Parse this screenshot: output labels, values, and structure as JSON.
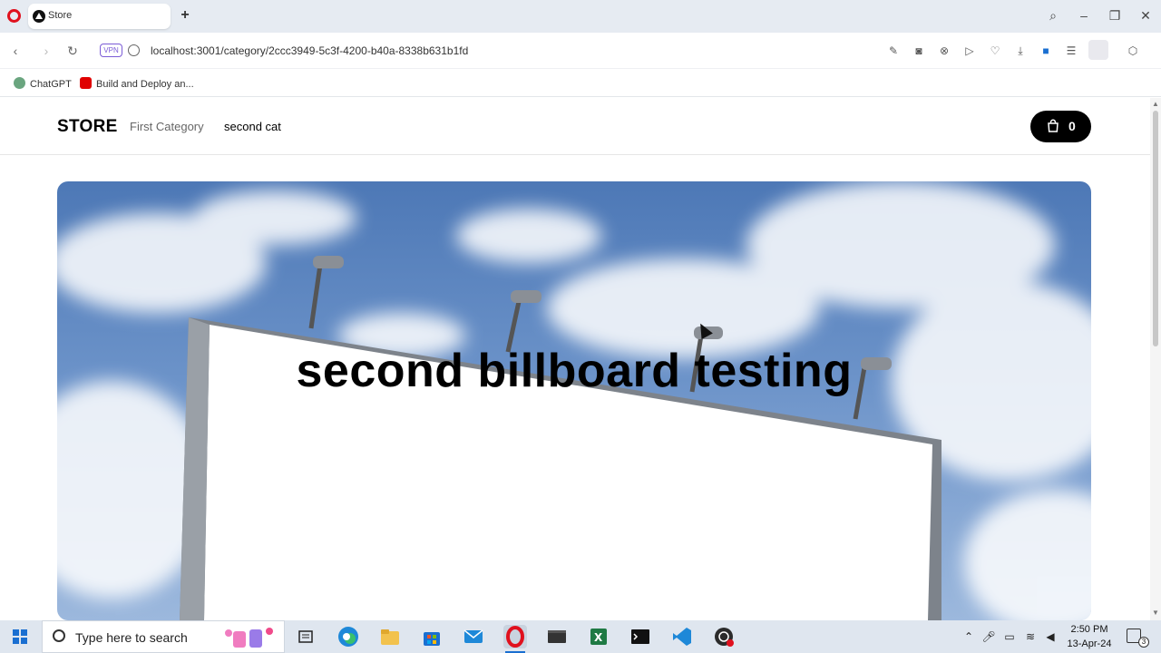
{
  "browser": {
    "tab_title": "Store",
    "url": "localhost:3001/category/2ccc3949-5c3f-4200-b40a-8338b631b1fd",
    "vpn_label": "VPN",
    "bookmarks": [
      "ChatGPT",
      "Build and Deploy an..."
    ]
  },
  "store": {
    "brand": "STORE",
    "nav": [
      "First Category",
      "second cat"
    ],
    "active_nav": "second cat",
    "cart_count": "0",
    "billboard_title": "second billboard testing"
  },
  "taskbar": {
    "search_placeholder": "Type here to search",
    "time": "2:50 PM",
    "date": "13-Apr-24",
    "notification_count": "3"
  },
  "colors": {
    "accent_black": "#000000",
    "sky": "#5f86c0",
    "opera_red": "#e0111e",
    "windows_blue": "#1a6fd1"
  }
}
